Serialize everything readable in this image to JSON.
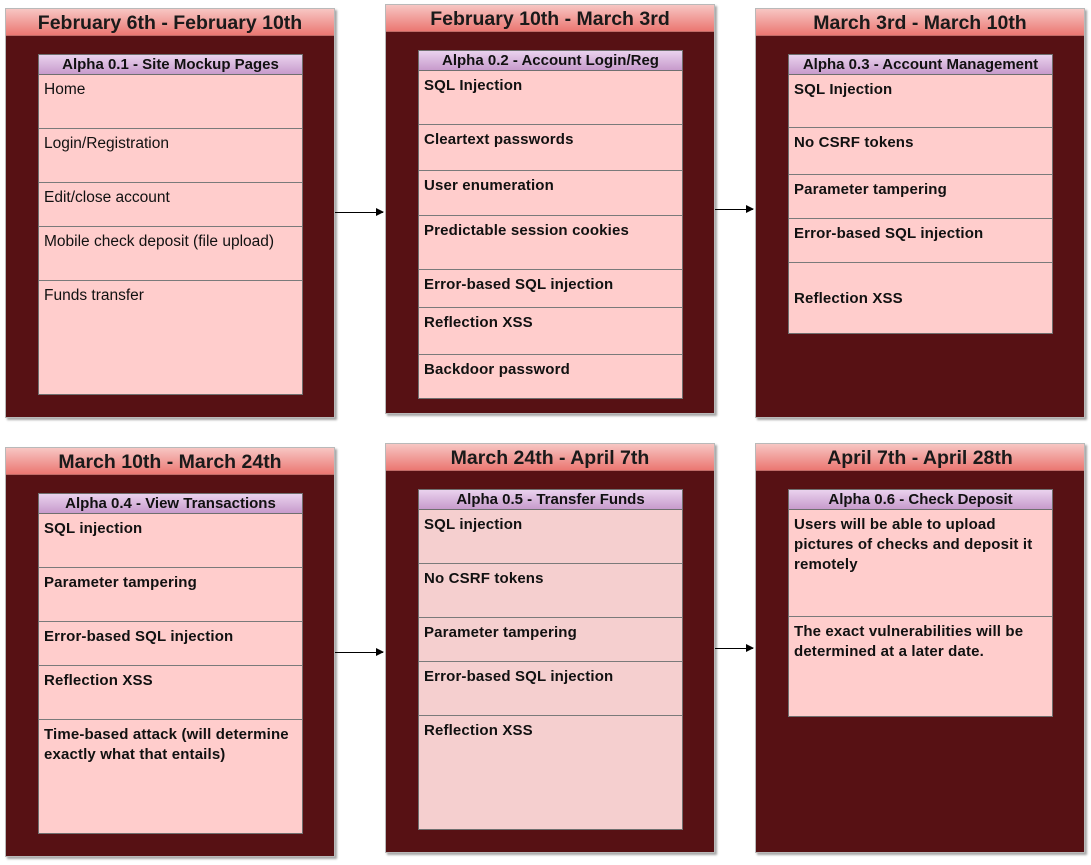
{
  "phases": [
    {
      "title": "February 6th - February 10th",
      "milestone": "Alpha 0.1 - Site Mockup Pages",
      "items": [
        "Home",
        "Login/Registration",
        "Edit/close account",
        "Mobile check deposit (file upload)",
        "Funds transfer"
      ]
    },
    {
      "title": "February 10th - March 3rd",
      "milestone": "Alpha 0.2 - Account Login/Reg",
      "items": [
        "SQL Injection",
        "Cleartext passwords",
        "User enumeration",
        "Predictable session cookies",
        "Error-based SQL injection",
        "Reflection XSS",
        "Backdoor password"
      ]
    },
    {
      "title": "March 3rd - March 10th",
      "milestone": "Alpha 0.3 - Account Management",
      "items": [
        "SQL Injection",
        "No CSRF tokens",
        "Parameter tampering",
        "Error-based SQL injection",
        "Reflection XSS"
      ]
    },
    {
      "title": "March 10th - March 24th",
      "milestone": "Alpha 0.4 - View Transactions",
      "items": [
        "SQL injection",
        "Parameter tampering",
        "Error-based SQL injection",
        "Reflection XSS",
        "Time-based attack (will determine exactly what that entails)"
      ]
    },
    {
      "title": "March 24th - April 7th",
      "milestone": "Alpha 0.5 - Transfer Funds",
      "items": [
        "SQL injection",
        "No CSRF tokens",
        "Parameter tampering",
        "Error-based SQL injection",
        "Reflection XSS"
      ]
    },
    {
      "title": "April 7th - April 28th",
      "milestone": "Alpha 0.6 - Check Deposit",
      "items": [
        "Users will be able to upload pictures of checks and deposit it remotely",
        "The exact vulnerabilities will be determined at a later date."
      ]
    }
  ],
  "colors": {
    "phase_background": "#571114",
    "phase_header": "#eb7772",
    "milestone_header": "#c79bcc",
    "milestone_body": "#ffcdcc"
  }
}
